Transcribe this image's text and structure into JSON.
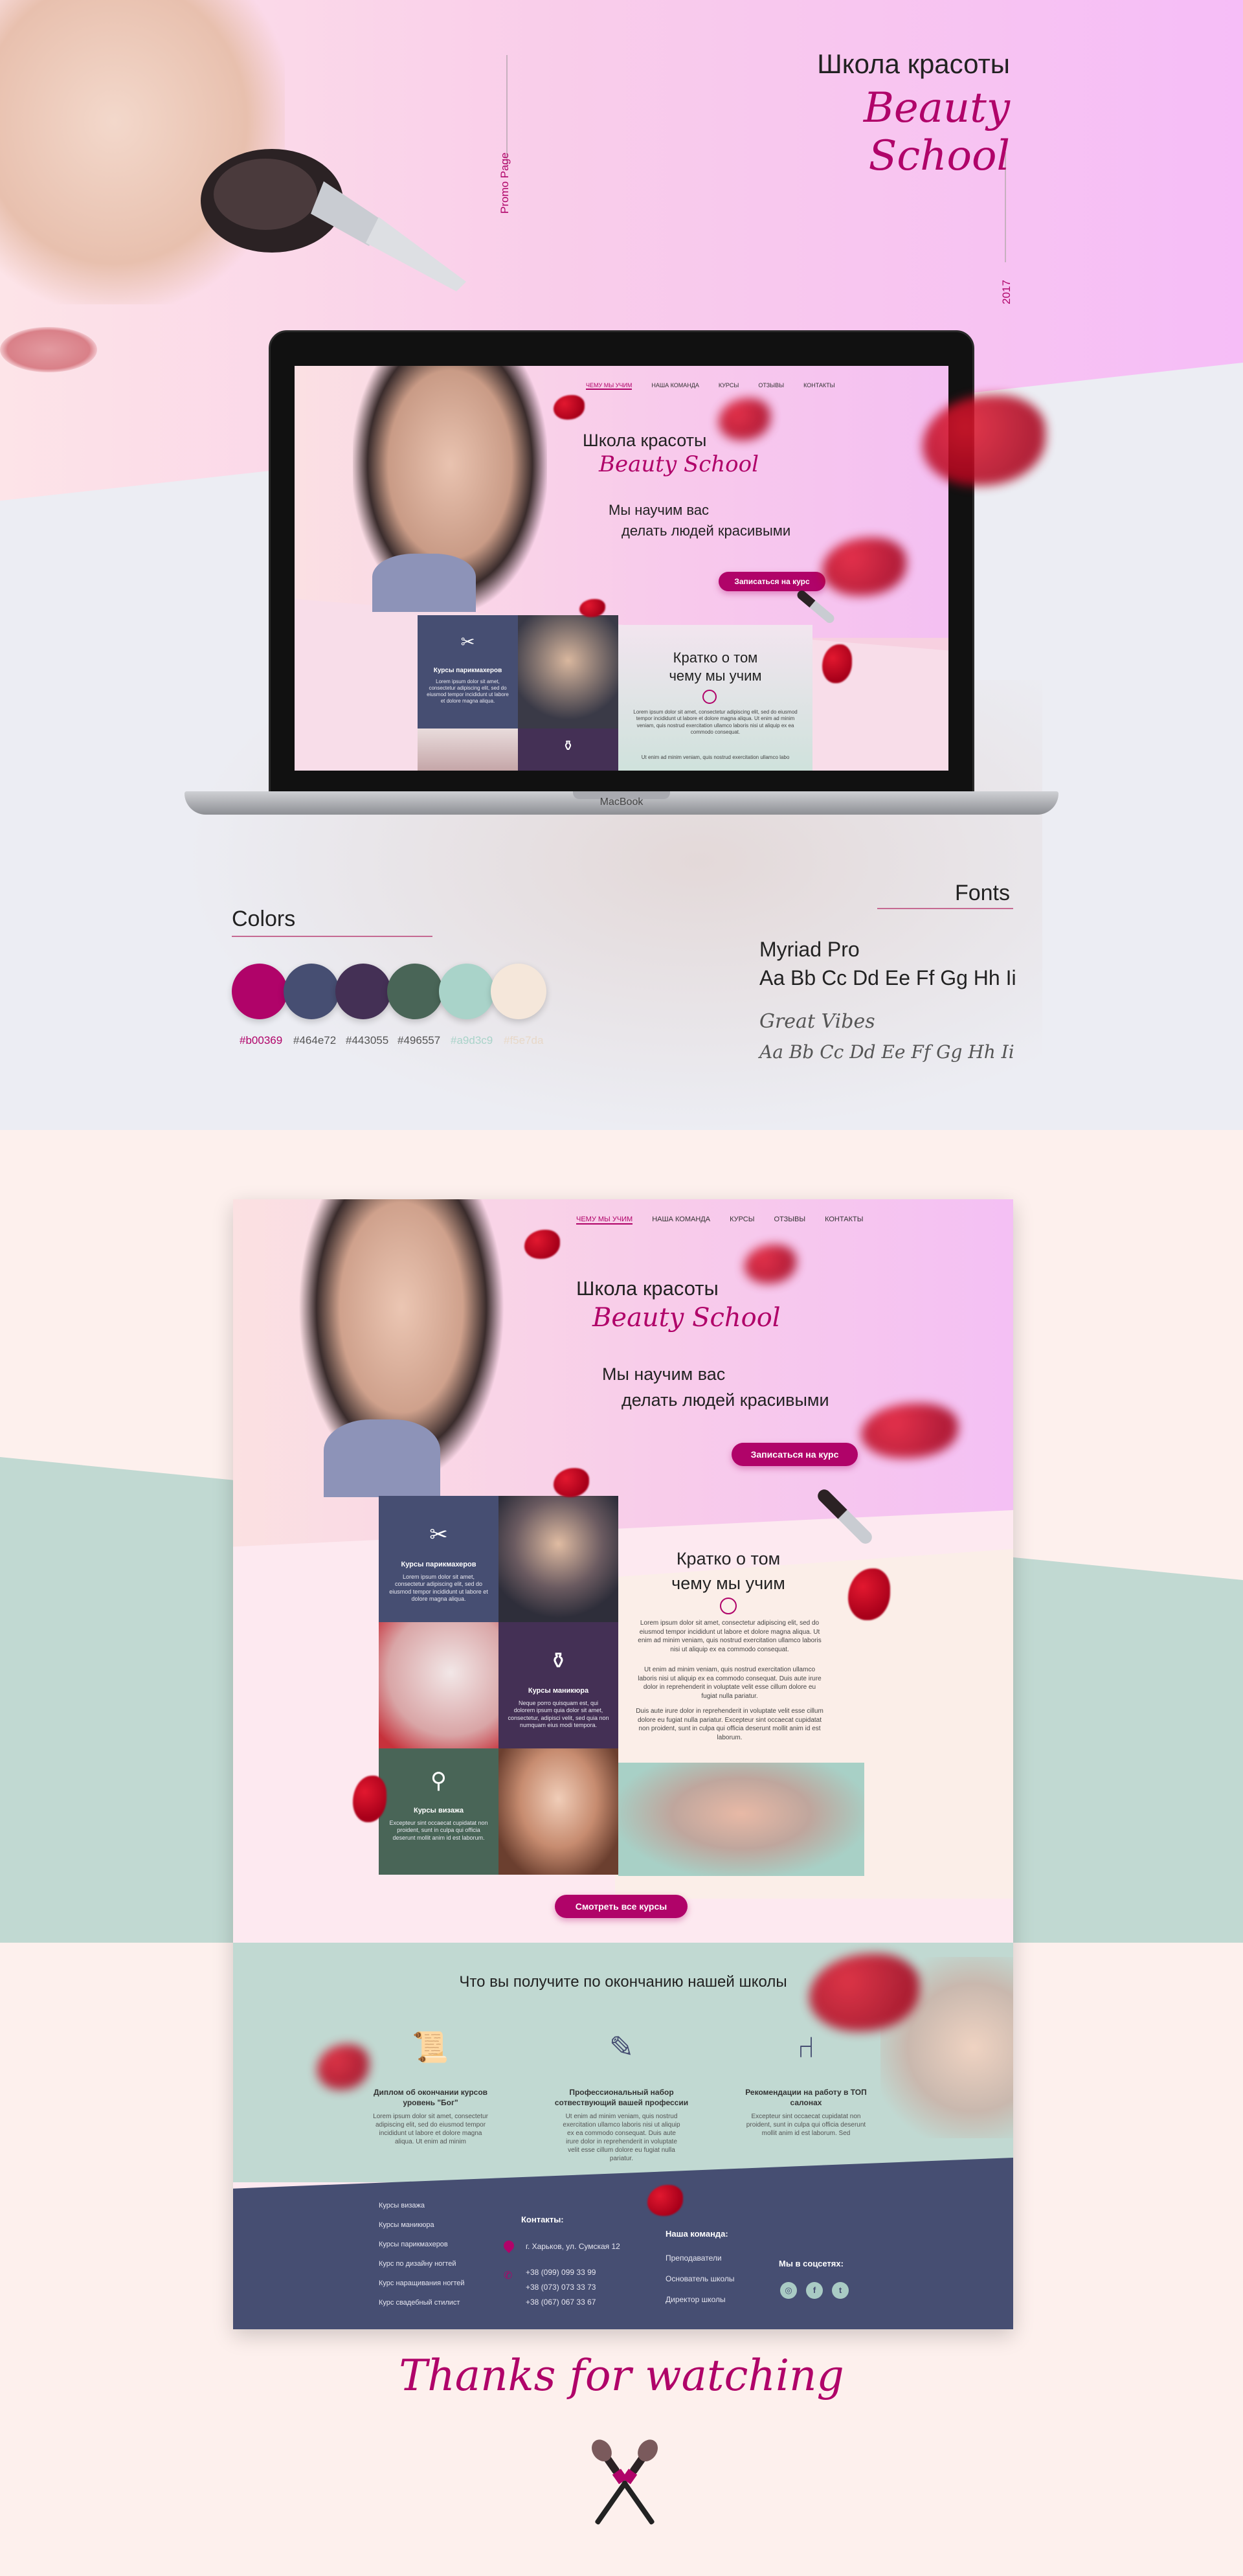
{
  "hero": {
    "title": "Школа красоты",
    "script_title": "Beauty School",
    "promo_label": "Promo Page",
    "year": "2017"
  },
  "laptop": {
    "brand_label": "MacBook"
  },
  "mini_site": {
    "nav": [
      "ЧЕМУ МЫ УЧИМ",
      "НАША КОМАНДА",
      "КУРСЫ",
      "ОТЗЫВЫ",
      "КОНТАКТЫ"
    ],
    "title": "Школа красоты",
    "script_title": "Beauty School",
    "tagline_1": "Мы научим вас",
    "tagline_2": "делать людей красивыми",
    "cta": "Записаться на курс",
    "about_title_1": "Кратко о том",
    "about_title_2": "чему мы учим",
    "tile_hair": "Курсы парикмахеров",
    "tile_text": "Lorem ipsum dolor sit amet, consectetur adipiscing elit, sed do eiusmod tempor incididunt ut labore et dolore magna aliqua.",
    "about_p1": "Lorem ipsum dolor sit amet, consectetur adipiscing elit, sed do eiusmod tempor incididunt ut labore et dolore magna aliqua. Ut enim ad minim veniam, quis nostrud exercitation ullamco laboris nisi ut aliquip ex ea commodo consequat.",
    "about_p2": "Ut enim ad minim veniam, quis nostrud exercitation ullamco labo"
  },
  "colors": {
    "title": "Colors",
    "swatches": [
      {
        "hex": "#b00369",
        "label": "#b00369"
      },
      {
        "hex": "#464e72",
        "label": "#464e72"
      },
      {
        "hex": "#443055",
        "label": "#443055"
      },
      {
        "hex": "#496557",
        "label": "#496557"
      },
      {
        "hex": "#a9d3c9",
        "label": "#a9d3c9"
      },
      {
        "hex": "#f5e7da",
        "label": "#f5e7da"
      }
    ]
  },
  "fonts": {
    "title": "Fonts",
    "font1_name": "Myriad Pro",
    "font1_sample": "Aa Bb Cc Dd Ee Ff Gg Hh Ii",
    "font2_name": "Great Vibes",
    "font2_sample": "Aa Bb Cc Dd Ee Ff Gg Hh Ii"
  },
  "site": {
    "nav": [
      "ЧЕМУ МЫ УЧИМ",
      "НАША КОМАНДА",
      "КУРСЫ",
      "ОТЗЫВЫ",
      "КОНТАКТЫ"
    ],
    "title": "Школа красоты",
    "script_title": "Beauty School",
    "tagline_1": "Мы научим вас",
    "tagline_2": "делать людей красивыми",
    "cta": "Записаться на курс",
    "about_title_1": "Кратко о том",
    "about_title_2": "чему мы учим",
    "about_p1": "Lorem ipsum dolor sit amet, consectetur adipiscing elit, sed do eiusmod tempor incididunt ut labore et dolore magna aliqua. Ut enim ad minim veniam, quis nostrud exercitation ullamco laboris nisi ut aliquip ex ea commodo consequat.",
    "about_p2": "Ut enim ad minim veniam, quis nostrud exercitation ullamco laboris nisi ut aliquip ex ea commodo consequat. Duis aute irure dolor in reprehenderit in voluptate velit esse cillum dolore eu fugiat nulla pariatur.",
    "about_p3": "Duis aute irure dolor in reprehenderit in voluptate velit esse cillum dolore eu fugiat nulla pariatur. Excepteur sint occaecat cupidatat non proident, sunt in culpa qui officia deserunt mollit anim id est laborum.",
    "tiles": {
      "hair_title": "Курсы парикмахеров",
      "hair_text": "Lorem ipsum dolor sit amet, consectetur adipiscing elit, sed do eiusmod tempor incididunt ut labore et dolore magna aliqua.",
      "manicure_title": "Курсы маникюра",
      "manicure_text": "Neque porro quisquam est, qui dolorem ipsum quia dolor sit amet, consectetur, adipisci velit, sed quia non numquam eius modi tempora.",
      "lash_title": "Курсы визажа",
      "lash_text": "Excepteur sint occaecat cupidatat non proident, sunt in culpa qui officia deserunt mollit anim id est laborum."
    },
    "all_courses": "Смотреть все курсы",
    "benefits_title": "Что вы получите по окончанию нашей школы",
    "benefits": [
      {
        "title": "Диплом об окончании курсов уровень \"Бог\"",
        "text": "Lorem ipsum dolor sit amet, consectetur adipiscing elit, sed do eiusmod tempor incididunt ut labore et dolore magna aliqua. Ut enim ad minim",
        "icon": "diploma-icon"
      },
      {
        "title": "Профессиональный набор сотвествующий вашей профессии",
        "text": "Ut enim ad minim veniam, quis nostrud exercitation ullamco laboris nisi ut aliquip ex ea commodo consequat. Duis aute irure dolor in reprehenderit in voluptate velit esse cillum dolore eu fugiat nulla pariatur.",
        "icon": "tools-icon"
      },
      {
        "title": "Рекомендации на работу в ТОП салонах",
        "text": "Excepteur sint occaecat cupidatat non proident, sunt in culpa qui officia deserunt mollit anim id est laborum. Sed",
        "icon": "salon-chair-icon"
      }
    ],
    "footer": {
      "courses": [
        "Курсы визажа",
        "Курсы маникюра",
        "Курсы парикмахеров",
        "Курс по дизайну ногтей",
        "Курс наращивания ногтей",
        "Курс свадебный стилист"
      ],
      "contacts_title": "Контакты:",
      "address": "г. Харьков, ул. Сумская 12",
      "phones": [
        "+38 (099) 099 33 99",
        "+38 (073) 073 33 73",
        "+38 (067) 067 33 67"
      ],
      "team_title": "Наша команда:",
      "team": [
        "Преподаватели",
        "Основатель школы",
        "Директор школы"
      ],
      "social_title": "Мы в соцсетях:"
    }
  },
  "thanks": "Thanks for watching"
}
